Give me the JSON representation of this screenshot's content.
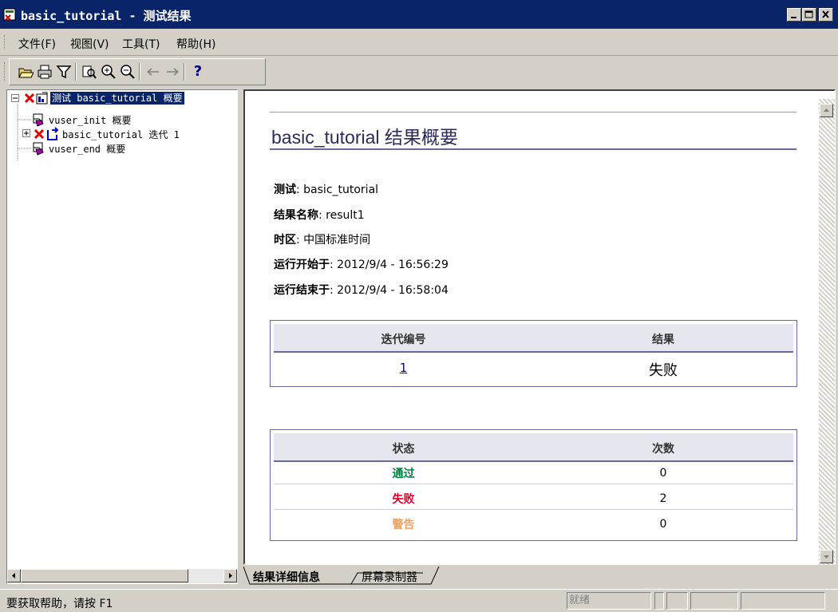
{
  "window": {
    "title": "basic_tutorial - 测试结果",
    "controls": [
      "minimize-icon",
      "maximize-icon",
      "close-icon"
    ]
  },
  "menu": [
    "文件(F)",
    "视图(V)",
    "工具(T)",
    "帮助(H)"
  ],
  "toolbar": {
    "buttons": [
      "open-folder-icon",
      "print-icon",
      "filter-icon",
      "find-icon",
      "zoom-in-icon",
      "zoom-out-icon",
      "back-arrow-icon",
      "forward-arrow-icon",
      "help-icon"
    ],
    "help_label": "?"
  },
  "tree": {
    "root": {
      "label": "测试 basic_tutorial 概要",
      "status": "failed",
      "selected": true
    },
    "children": [
      {
        "label": "vuser_init 概要",
        "expandable": false
      },
      {
        "label": "basic_tutorial 迭代 1",
        "expandable": true,
        "status": "failed"
      },
      {
        "label": "vuser_end 概要",
        "expandable": false
      }
    ]
  },
  "summary": {
    "title": "basic_tutorial 结果概要",
    "fields": [
      {
        "label": "测试",
        "value": ": basic_tutorial"
      },
      {
        "label": "结果名称",
        "value": ": result1"
      },
      {
        "label": "时区",
        "value": ": 中国标准时间"
      },
      {
        "label": "运行开始于",
        "value": ": 2012/9/4 - 16:56:29"
      },
      {
        "label": "运行结束于",
        "value": ": 2012/9/4 - 16:58:04"
      }
    ],
    "iterations_table": {
      "headers": [
        "迭代编号",
        "结果"
      ],
      "rows": [
        {
          "iteration": "1",
          "result": "失败"
        }
      ]
    },
    "status_table": {
      "headers": [
        "状态",
        "次数"
      ],
      "rows": [
        {
          "status": "通过",
          "count": "0",
          "color": "#008040"
        },
        {
          "status": "失败",
          "count": "2",
          "color": "#e0002a"
        },
        {
          "status": "警告",
          "count": "0",
          "color": "#f0a060"
        }
      ]
    }
  },
  "tabs": [
    "结果详细信息",
    "屏幕录制器"
  ],
  "statusbar": {
    "help": "要获取帮助，请按 F1",
    "state": "就绪"
  }
}
